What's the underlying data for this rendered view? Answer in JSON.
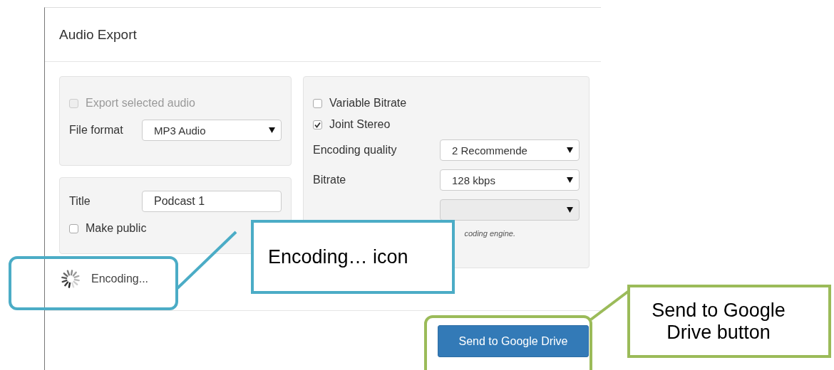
{
  "dialog": {
    "title": "Audio Export"
  },
  "export_panel": {
    "export_selected": {
      "label": "Export selected audio",
      "checked": false,
      "disabled": true
    },
    "file_format": {
      "label": "File format",
      "value": "MP3 Audio"
    }
  },
  "details_panel": {
    "title_field": {
      "label": "Title",
      "value": "Podcast 1"
    },
    "make_public": {
      "label": "Make public",
      "checked": false,
      "disabled": false
    }
  },
  "encoding_panel": {
    "options": [
      {
        "label": "Variable Bitrate",
        "checked": false,
        "disabled": false
      },
      {
        "label": "Joint Stereo",
        "checked": true,
        "disabled": false
      }
    ],
    "selects": [
      {
        "label": "Encoding quality",
        "value": "2 Recommende",
        "disabled": false
      },
      {
        "label": "Bitrate",
        "value": "128 kbps",
        "disabled": false
      },
      {
        "disabled": true
      }
    ],
    "hint": "coding engine."
  },
  "status": {
    "text": "Encoding..."
  },
  "footer": {
    "button": "Send to Google Drive"
  },
  "callouts": [
    {
      "text": "Encoding… icon",
      "color": "#4bacc6"
    },
    {
      "text": "Send to Google Drive button",
      "color": "#9bbb59"
    }
  ]
}
